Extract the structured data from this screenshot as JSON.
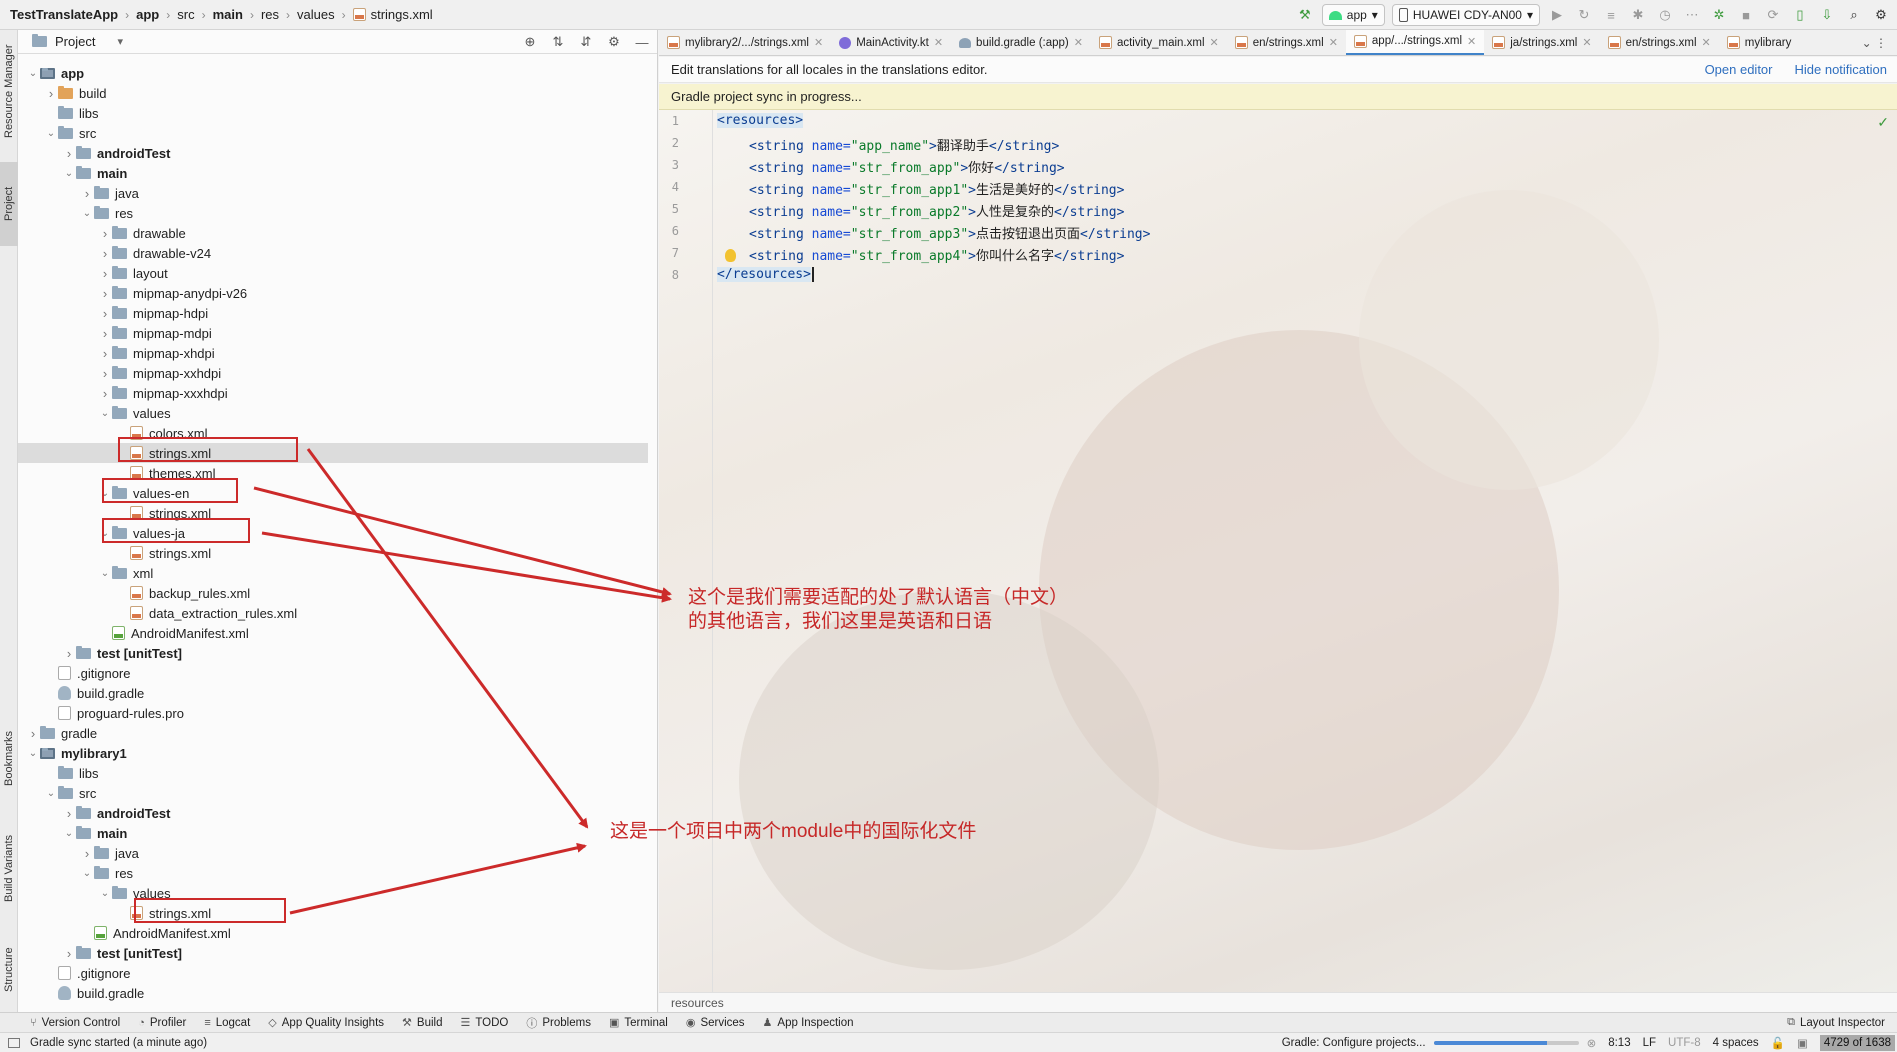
{
  "navbar": {
    "crumbs": [
      "TestTranslateApp",
      "app",
      "src",
      "main",
      "res",
      "values",
      "strings.xml"
    ],
    "run_config": "app",
    "device": "HUAWEI CDY-AN00"
  },
  "left_stripe": [
    "Resource Manager",
    "Project",
    "Bookmarks",
    "Build Variants",
    "Structure"
  ],
  "project_panel": {
    "title": "Project",
    "tree": [
      {
        "label": "app",
        "bold": true,
        "exp": "open",
        "lvl": 1,
        "icon": "module"
      },
      {
        "label": "build",
        "exp": "closed",
        "lvl": 2,
        "icon": "folder-orange"
      },
      {
        "label": "libs",
        "lvl": 2,
        "icon": "folder"
      },
      {
        "label": "src",
        "exp": "open",
        "lvl": 2,
        "icon": "folder"
      },
      {
        "label": "androidTest",
        "bold": true,
        "exp": "closed",
        "lvl": 3,
        "icon": "folder"
      },
      {
        "label": "main",
        "bold": true,
        "exp": "open",
        "lvl": 3,
        "icon": "folder"
      },
      {
        "label": "java",
        "exp": "closed",
        "lvl": 4,
        "icon": "folder"
      },
      {
        "label": "res",
        "exp": "open",
        "lvl": 4,
        "icon": "folder"
      },
      {
        "label": "drawable",
        "exp": "closed",
        "lvl": 5,
        "icon": "folder"
      },
      {
        "label": "drawable-v24",
        "exp": "closed",
        "lvl": 5,
        "icon": "folder"
      },
      {
        "label": "layout",
        "exp": "closed",
        "lvl": 5,
        "icon": "folder"
      },
      {
        "label": "mipmap-anydpi-v26",
        "exp": "closed",
        "lvl": 5,
        "icon": "folder"
      },
      {
        "label": "mipmap-hdpi",
        "exp": "closed",
        "lvl": 5,
        "icon": "folder"
      },
      {
        "label": "mipmap-mdpi",
        "exp": "closed",
        "lvl": 5,
        "icon": "folder"
      },
      {
        "label": "mipmap-xhdpi",
        "exp": "closed",
        "lvl": 5,
        "icon": "folder"
      },
      {
        "label": "mipmap-xxhdpi",
        "exp": "closed",
        "lvl": 5,
        "icon": "folder"
      },
      {
        "label": "mipmap-xxxhdpi",
        "exp": "closed",
        "lvl": 5,
        "icon": "folder"
      },
      {
        "label": "values",
        "exp": "open",
        "lvl": 5,
        "icon": "folder"
      },
      {
        "label": "colors.xml",
        "lvl": 6,
        "icon": "xml"
      },
      {
        "label": "strings.xml",
        "lvl": 6,
        "icon": "xml",
        "selected": true
      },
      {
        "label": "themes.xml",
        "lvl": 6,
        "icon": "xml"
      },
      {
        "label": "values-en",
        "exp": "open",
        "lvl": 5,
        "icon": "folder"
      },
      {
        "label": "strings.xml",
        "lvl": 6,
        "icon": "xml"
      },
      {
        "label": "values-ja",
        "exp": "open",
        "lvl": 5,
        "icon": "folder"
      },
      {
        "label": "strings.xml",
        "lvl": 6,
        "icon": "xml"
      },
      {
        "label": "xml",
        "exp": "open",
        "lvl": 5,
        "icon": "folder"
      },
      {
        "label": "backup_rules.xml",
        "lvl": 6,
        "icon": "xml"
      },
      {
        "label": "data_extraction_rules.xml",
        "lvl": 6,
        "icon": "xml"
      },
      {
        "label": "AndroidManifest.xml",
        "lvl": 5,
        "icon": "manifest"
      },
      {
        "label": "test [unitTest]",
        "bold": true,
        "exp": "closed",
        "lvl": 3,
        "icon": "folder"
      },
      {
        "label": ".gitignore",
        "lvl": 2,
        "icon": "file"
      },
      {
        "label": "build.gradle",
        "lvl": 2,
        "icon": "gradle"
      },
      {
        "label": "proguard-rules.pro",
        "lvl": 2,
        "icon": "file"
      },
      {
        "label": "gradle",
        "exp": "closed",
        "lvl": 1,
        "icon": "folder"
      },
      {
        "label": "mylibrary1",
        "bold": true,
        "exp": "open",
        "lvl": 1,
        "icon": "module"
      },
      {
        "label": "libs",
        "lvl": 2,
        "icon": "folder"
      },
      {
        "label": "src",
        "exp": "open",
        "lvl": 2,
        "icon": "folder"
      },
      {
        "label": "androidTest",
        "bold": true,
        "exp": "closed",
        "lvl": 3,
        "icon": "folder"
      },
      {
        "label": "main",
        "bold": true,
        "exp": "open",
        "lvl": 3,
        "icon": "folder"
      },
      {
        "label": "java",
        "exp": "closed",
        "lvl": 4,
        "icon": "folder"
      },
      {
        "label": "res",
        "exp": "open",
        "lvl": 4,
        "icon": "folder"
      },
      {
        "label": "values",
        "exp": "open",
        "lvl": 5,
        "icon": "folder"
      },
      {
        "label": "strings.xml",
        "lvl": 6,
        "icon": "xml"
      },
      {
        "label": "AndroidManifest.xml",
        "lvl": 4,
        "icon": "manifest"
      },
      {
        "label": "test [unitTest]",
        "bold": true,
        "exp": "closed",
        "lvl": 3,
        "icon": "folder"
      },
      {
        "label": ".gitignore",
        "lvl": 2,
        "icon": "file"
      },
      {
        "label": "build.gradle",
        "lvl": 2,
        "icon": "gradle"
      }
    ]
  },
  "editor_tabs": [
    {
      "label": "mylibrary2/.../strings.xml",
      "icon": "xml"
    },
    {
      "label": "MainActivity.kt",
      "icon": "kotlin"
    },
    {
      "label": "build.gradle (:app)",
      "icon": "gradle"
    },
    {
      "label": "activity_main.xml",
      "icon": "xml"
    },
    {
      "label": "en/strings.xml",
      "icon": "xml"
    },
    {
      "label": "app/.../strings.xml",
      "icon": "xml",
      "active": true
    },
    {
      "label": "ja/strings.xml",
      "icon": "xml"
    },
    {
      "label": "en/strings.xml",
      "icon": "xml"
    },
    {
      "label": "mylibrary",
      "icon": "xml",
      "noclose": true
    }
  ],
  "banner": {
    "text": "Edit translations for all locales in the translations editor.",
    "open_editor": "Open editor",
    "hide": "Hide notification"
  },
  "sync_banner": "Gradle project sync in progress...",
  "code": {
    "line_numbers": [
      "1",
      "2",
      "3",
      "4",
      "5",
      "6",
      "7",
      "8"
    ],
    "open_tag": "<resources>",
    "close_tag": "</resources>",
    "strings": [
      {
        "name": "app_name",
        "value": "翻译助手"
      },
      {
        "name": "str_from_app",
        "value": "你好"
      },
      {
        "name": "str_from_app1",
        "value": "生活是美好的"
      },
      {
        "name": "str_from_app2",
        "value": "人性是复杂的"
      },
      {
        "name": "str_from_app3",
        "value": "点击按钮退出页面"
      },
      {
        "name": "str_from_app4",
        "value": "你叫什么名字"
      }
    ]
  },
  "editor_breadcrumb": "resources",
  "annotations": {
    "note1_line1": "这个是我们需要适配的处了默认语言（中文）",
    "note1_line2": "的其他语言，我们这里是英语和日语",
    "note2": "这是一个项目中两个module中的国际化文件"
  },
  "tool_windows": [
    "Version Control",
    "Profiler",
    "Logcat",
    "App Quality Insights",
    "Build",
    "TODO",
    "Problems",
    "Terminal",
    "Services",
    "App Inspection"
  ],
  "layout_inspector": "Layout Inspector",
  "status": {
    "left": "Gradle sync started (a minute ago)",
    "task": "Gradle: Configure projects...",
    "progress": 0.78,
    "position": "8:13",
    "line_sep": "LF",
    "encoding": "UTF-8",
    "indent": "4 spaces",
    "memory": "4729 of 1638"
  },
  "colors": {
    "annotation": "#cc2a2a",
    "accent": "#4083c9"
  }
}
